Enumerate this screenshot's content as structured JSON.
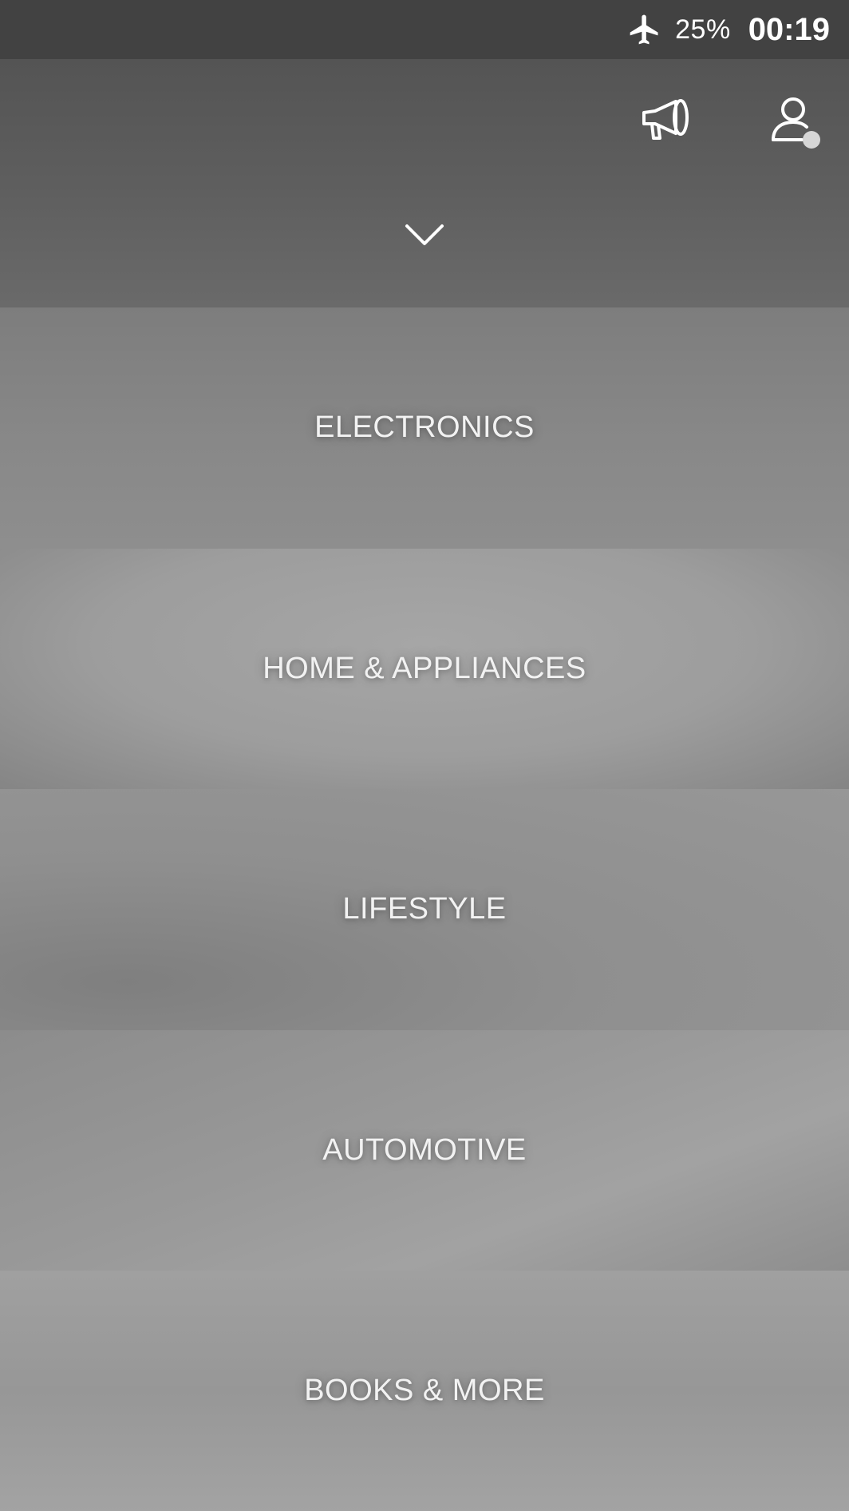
{
  "status_bar": {
    "airplane_icon": "airplane-icon",
    "battery": "25%",
    "time": "00:19"
  },
  "header": {
    "announcement_icon": "megaphone-icon",
    "profile_icon": "user-icon",
    "expand_icon": "chevron-down-icon"
  },
  "categories": [
    {
      "label": "ELECTRONICS"
    },
    {
      "label": "HOME & APPLIANCES"
    },
    {
      "label": "LIFESTYLE"
    },
    {
      "label": "AUTOMOTIVE"
    },
    {
      "label": "BOOKS & MORE"
    }
  ],
  "colors": {
    "status_bar_bg": "#424242",
    "header_bg": "#5a5a5a",
    "text": "#f2f2f2",
    "notification_dot": "#d6d6d6"
  }
}
